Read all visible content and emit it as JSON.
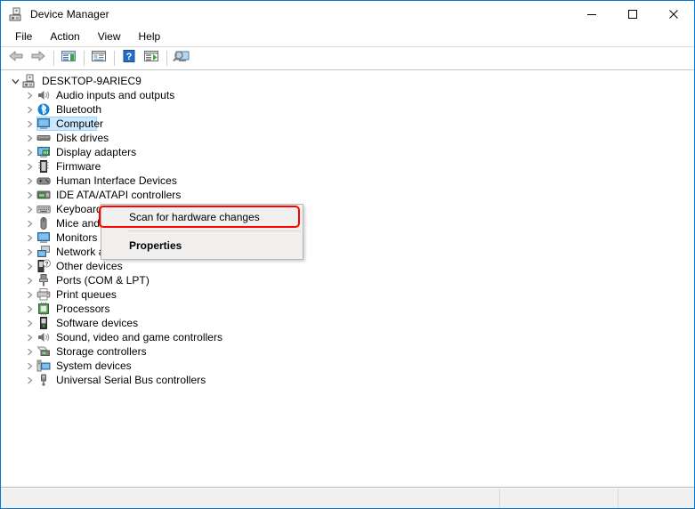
{
  "window": {
    "title": "Device Manager",
    "icon": "device-manager-icon",
    "caption_buttons": [
      {
        "name": "minimize-button",
        "glyph": "minimize"
      },
      {
        "name": "maximize-button",
        "glyph": "maximize"
      },
      {
        "name": "close-button",
        "glyph": "close"
      }
    ]
  },
  "menubar": {
    "items": [
      {
        "label": "File",
        "name": "menu-file"
      },
      {
        "label": "Action",
        "name": "menu-action"
      },
      {
        "label": "View",
        "name": "menu-view"
      },
      {
        "label": "Help",
        "name": "menu-help"
      }
    ]
  },
  "toolbar": {
    "buttons": [
      {
        "name": "back-button",
        "icon": "back-arrow-icon"
      },
      {
        "name": "forward-button",
        "icon": "forward-arrow-icon"
      },
      {
        "name": "show-hide-console-tree-button",
        "icon": "console-tree-icon"
      },
      {
        "name": "properties-button",
        "icon": "properties-window-icon"
      },
      {
        "name": "help-button",
        "icon": "question-mark-icon"
      },
      {
        "name": "update-driver-button",
        "icon": "update-driver-icon"
      },
      {
        "name": "scan-for-hardware-changes-button",
        "icon": "scan-hardware-icon"
      }
    ]
  },
  "tree": {
    "root": {
      "label": "DESKTOP-9ARIEC9",
      "icon": "computer-node-icon",
      "expanded": true
    },
    "items": [
      {
        "label": "Audio inputs and outputs",
        "icon": "speaker-icon"
      },
      {
        "label": "Bluetooth",
        "icon": "bluetooth-icon"
      },
      {
        "label": "Computer",
        "icon": "monitor-icon",
        "selected": true
      },
      {
        "label": "Disk drives",
        "icon": "disk-drive-icon"
      },
      {
        "label": "Display adapters",
        "icon": "display-adapter-icon"
      },
      {
        "label": "Firmware",
        "icon": "firmware-chip-icon"
      },
      {
        "label": "Human Interface Devices",
        "icon": "gamepad-icon"
      },
      {
        "label": "IDE ATA/ATAPI controllers",
        "icon": "ide-controller-icon"
      },
      {
        "label": "Keyboards",
        "icon": "keyboard-icon"
      },
      {
        "label": "Mice and other pointing devices",
        "icon": "mouse-icon"
      },
      {
        "label": "Monitors",
        "icon": "monitor-icon"
      },
      {
        "label": "Network adapters",
        "icon": "network-adapter-icon"
      },
      {
        "label": "Other devices",
        "icon": "unknown-device-icon"
      },
      {
        "label": "Ports (COM & LPT)",
        "icon": "port-icon"
      },
      {
        "label": "Print queues",
        "icon": "printer-icon"
      },
      {
        "label": "Processors",
        "icon": "processor-icon"
      },
      {
        "label": "Software devices",
        "icon": "software-device-icon"
      },
      {
        "label": "Sound, video and game controllers",
        "icon": "speaker-icon"
      },
      {
        "label": "Storage controllers",
        "icon": "storage-controller-icon"
      },
      {
        "label": "System devices",
        "icon": "system-device-icon"
      },
      {
        "label": "Universal Serial Bus controllers",
        "icon": "usb-icon"
      }
    ]
  },
  "context_menu": {
    "visible": true,
    "items": [
      {
        "label": "Scan for hardware changes",
        "name": "ctx-scan-for-hardware-changes",
        "bold": false,
        "highlighted": true
      },
      {
        "label": "Properties",
        "name": "ctx-properties",
        "bold": true,
        "highlighted": false
      }
    ]
  },
  "highlight": {
    "color": "#ff0000",
    "target": "Scan for hardware changes"
  },
  "statusbar": {
    "cells": [
      "",
      "",
      ""
    ]
  }
}
